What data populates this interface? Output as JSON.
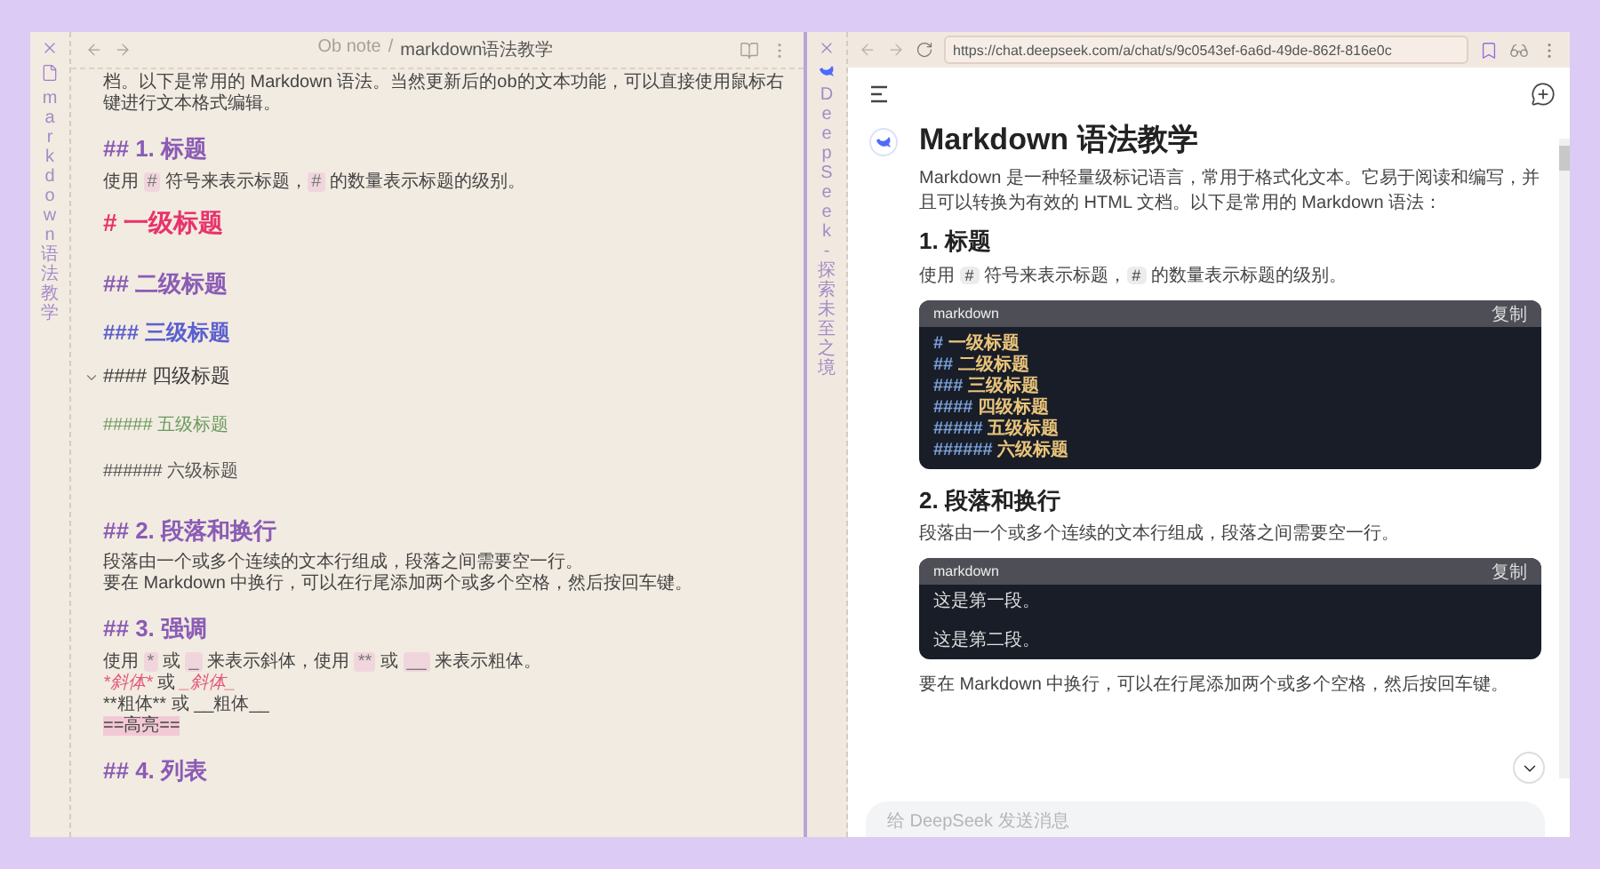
{
  "left_pane": {
    "tab_title": "markdown语法教学",
    "breadcrumb": {
      "folder": "Ob note",
      "separator": "/",
      "file": "markdown语法教学"
    },
    "blocks": [
      {
        "kind": "para",
        "lines": [
          [
            {
              "kind": "plain",
              "text": "档。以下是常用的 Markdown 语法。当然更新后的ob的文本功能，可以直接使用鼠标右键进行文本格式编辑。"
            }
          ]
        ]
      },
      {
        "kind": "h2",
        "text": "## 1. 标题",
        "fold_icon": false
      },
      {
        "kind": "para",
        "lines": [
          [
            {
              "kind": "plain",
              "text": "使用 "
            },
            {
              "kind": "code",
              "text": "#"
            },
            {
              "kind": "plain",
              "text": " 符号来表示标题，"
            },
            {
              "kind": "code",
              "text": "#"
            },
            {
              "kind": "plain",
              "text": " 的数量表示标题的级别。"
            }
          ]
        ]
      },
      {
        "kind": "h1",
        "text": "# 一级标题",
        "fold_icon": false
      },
      {
        "kind": "h2",
        "text": "## 二级标题",
        "fold_icon": false
      },
      {
        "kind": "h3",
        "text": "### 三级标题",
        "fold_icon": false
      },
      {
        "kind": "h4",
        "text": "#### 四级标题",
        "fold_icon": true
      },
      {
        "kind": "h5",
        "text": "##### 五级标题",
        "fold_icon": false
      },
      {
        "kind": "h6",
        "text": "###### 六级标题",
        "fold_icon": false
      },
      {
        "kind": "h2",
        "text": "## 2. 段落和换行",
        "fold_icon": false
      },
      {
        "kind": "para",
        "lines": [
          [
            {
              "kind": "plain",
              "text": "段落由一个或多个连续的文本行组成，段落之间需要空一行。"
            }
          ],
          [
            {
              "kind": "plain",
              "text": "要在 Markdown 中换行，可以在行尾添加两个或多个空格，然后按回车键。"
            }
          ]
        ]
      },
      {
        "kind": "h2",
        "text": "## 3. 强调",
        "fold_icon": false
      },
      {
        "kind": "para",
        "lines": [
          [
            {
              "kind": "plain",
              "text": "使用 "
            },
            {
              "kind": "code",
              "text": "*"
            },
            {
              "kind": "plain",
              "text": " 或 "
            },
            {
              "kind": "code",
              "text": "_"
            },
            {
              "kind": "plain",
              "text": " 来表示斜体，使用 "
            },
            {
              "kind": "code",
              "text": "**"
            },
            {
              "kind": "plain",
              "text": " 或 "
            },
            {
              "kind": "code",
              "text": "__"
            },
            {
              "kind": "plain",
              "text": " 来表示粗体。"
            }
          ],
          [
            {
              "kind": "italic",
              "text": "*斜体*"
            },
            {
              "kind": "plain",
              "text": " 或 "
            },
            {
              "kind": "italic",
              "text": "_斜体_"
            }
          ],
          [
            {
              "kind": "plain",
              "text": "**粗体** 或 __粗体__"
            }
          ],
          [
            {
              "kind": "mark",
              "text": "==高亮=="
            }
          ]
        ]
      },
      {
        "kind": "h2",
        "text": "## 4. 列表",
        "fold_icon": false
      }
    ]
  },
  "right_pane": {
    "tab_title": "DeepSeek - 探索未至之境",
    "url": "https://chat.deepseek.com/a/chat/s/9c0543ef-6a6d-49de-862f-816e0c",
    "title": "Markdown 语法教学",
    "blocks": [
      {
        "kind": "para",
        "segments": [
          {
            "kind": "plain",
            "text": "Markdown 是一种轻量级标记语言，常用于格式化文本。它易于阅读和编写，并且可以转换为有效的 HTML 文档。以下是常用的 Markdown 语法："
          }
        ]
      },
      {
        "kind": "heading",
        "text": "1. 标题"
      },
      {
        "kind": "para",
        "segments": [
          {
            "kind": "plain",
            "text": "使用 "
          },
          {
            "kind": "code",
            "text": "#"
          },
          {
            "kind": "plain",
            "text": " 符号来表示标题，"
          },
          {
            "kind": "code",
            "text": "#"
          },
          {
            "kind": "plain",
            "text": " 的数量表示标题的级别。"
          }
        ]
      },
      {
        "kind": "code",
        "language": "markdown",
        "copy": "复制",
        "lines": [
          {
            "prefix": "#",
            "text": "一级标题"
          },
          {
            "prefix": "##",
            "text": "二级标题"
          },
          {
            "prefix": "###",
            "text": "三级标题"
          },
          {
            "prefix": "####",
            "text": "四级标题"
          },
          {
            "prefix": "#####",
            "text": "五级标题"
          },
          {
            "prefix": "######",
            "text": "六级标题"
          }
        ]
      },
      {
        "kind": "heading",
        "text": "2. 段落和换行"
      },
      {
        "kind": "para",
        "segments": [
          {
            "kind": "plain",
            "text": "段落由一个或多个连续的文本行组成，段落之间需要空一行。"
          }
        ]
      },
      {
        "kind": "code",
        "language": "markdown",
        "copy": "复制",
        "lines": [
          {
            "text": "这是第一段。"
          },
          {
            "text": "这是第二段。"
          }
        ]
      },
      {
        "kind": "para",
        "segments": [
          {
            "kind": "plain",
            "text": "要在 Markdown 中换行，可以在行尾添加两个或多个空格，然后按回车键。"
          }
        ]
      }
    ],
    "input": {
      "placeholder": "给 DeepSeek 发送消息"
    }
  }
}
